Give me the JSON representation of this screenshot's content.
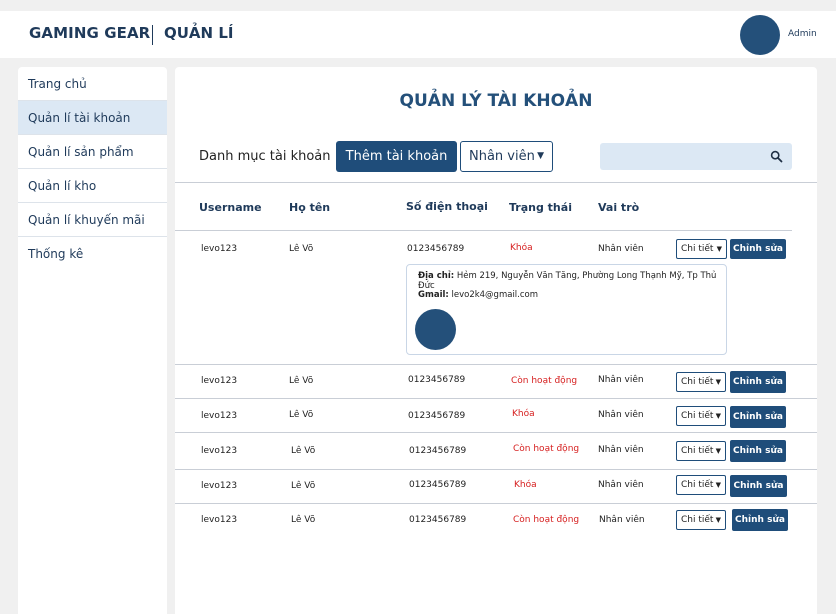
{
  "header": {
    "brand": "GAMING GEAR",
    "section": "QUẢN LÍ",
    "user_label": "Admin"
  },
  "sidebar": {
    "items": [
      {
        "label": "Trang chủ"
      },
      {
        "label": "Quản lí tài khoản"
      },
      {
        "label": "Quản lí sản phẩm"
      },
      {
        "label": "Quản lí kho"
      },
      {
        "label": "Quản lí khuyến mãi"
      },
      {
        "label": "Thống kê"
      }
    ],
    "active_index": 1
  },
  "main": {
    "title": "QUẢN LÝ TÀI KHOẢN",
    "toolbar": {
      "category_label": "Danh mục tài khoản",
      "add_button": "Thêm tài khoản",
      "role_filter": "Nhân viên",
      "search_placeholder": ""
    },
    "table": {
      "columns": [
        "Username",
        "Họ tên",
        "Số điện thoại",
        "Trạng thái",
        "Vai trò"
      ],
      "detail_label": "Chi tiết",
      "edit_label": "Chỉnh sửa",
      "rows": [
        {
          "username": "levo123",
          "name": "Lê Võ",
          "phone": "0123456789",
          "status": "Khóa",
          "role": "Nhân viên"
        },
        {
          "username": "levo123",
          "name": "Lê Võ",
          "phone": "0123456789",
          "status": "Còn hoạt động",
          "role": "Nhân viên"
        },
        {
          "username": "levo123",
          "name": "Lê Võ",
          "phone": "0123456789",
          "status": "Khóa",
          "role": "Nhân viên"
        },
        {
          "username": "levo123",
          "name": "Lê Võ",
          "phone": "0123456789",
          "status": "Còn hoạt động",
          "role": "Nhân viên"
        },
        {
          "username": "levo123",
          "name": "Lê Võ",
          "phone": "0123456789",
          "status": "Khóa",
          "role": "Nhân viên"
        },
        {
          "username": "levo123",
          "name": "Lê Võ",
          "phone": "0123456789",
          "status": "Còn hoạt động",
          "role": "Nhân viên"
        }
      ]
    },
    "detail": {
      "address_label": "Địa chỉ:",
      "address": "Hẻm 219, Nguyễn Văn Tăng, Phường Long Thạnh Mỹ, Tp Thủ Đức",
      "email_label": "Gmail:",
      "email": "levo2k4@gmail.com"
    }
  },
  "colors": {
    "primary": "#1f4d7a",
    "title": "#24507a",
    "status_red": "#d61f1f",
    "active_bg": "#dce8f4"
  },
  "icons": {
    "search": "search-icon",
    "caret": "chevron-down-icon"
  }
}
